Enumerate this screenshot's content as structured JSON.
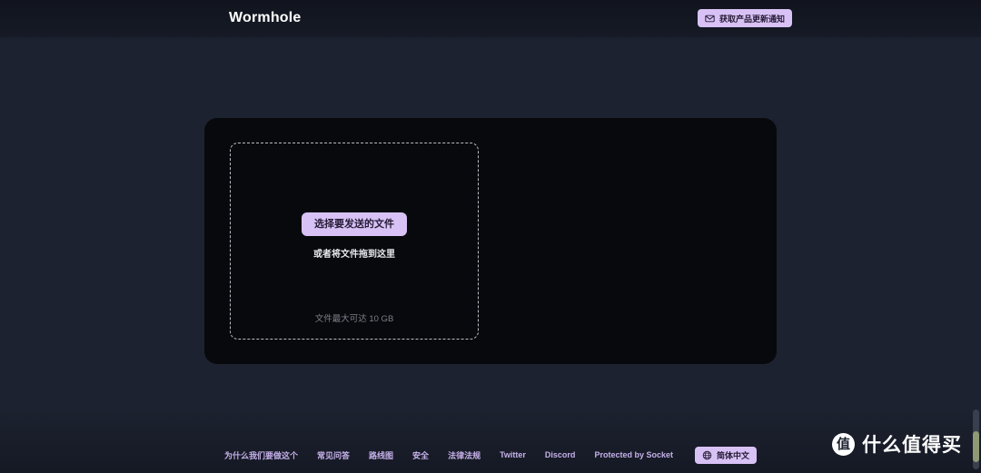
{
  "header": {
    "brand": "Wormhole",
    "notify_button": {
      "label": "获取产品更新通知",
      "icon": "mail-icon"
    }
  },
  "main": {
    "dropzone": {
      "select_button_label": "选择要发送的文件",
      "drag_hint": "或者将文件拖到这里",
      "size_hint": "文件最大可达 10 GB"
    }
  },
  "footer": {
    "links": [
      {
        "label": "为什么我们要做这个"
      },
      {
        "label": "常见问答"
      },
      {
        "label": "路线图"
      },
      {
        "label": "安全"
      },
      {
        "label": "法律法规"
      },
      {
        "label": "Twitter"
      },
      {
        "label": "Discord"
      },
      {
        "label": "Protected by Socket"
      }
    ],
    "language_button": {
      "label": "简体中文",
      "icon": "globe-icon"
    }
  },
  "watermark": {
    "logo_glyph": "值",
    "text": "什么值得买"
  },
  "colors": {
    "page_background": "#1d2230",
    "header_background": "#11141d",
    "card_background": "#08090c",
    "accent_purple": "#d8c2f5",
    "link_purple": "#c6b1ea",
    "muted_text": "#7b7f8a"
  }
}
